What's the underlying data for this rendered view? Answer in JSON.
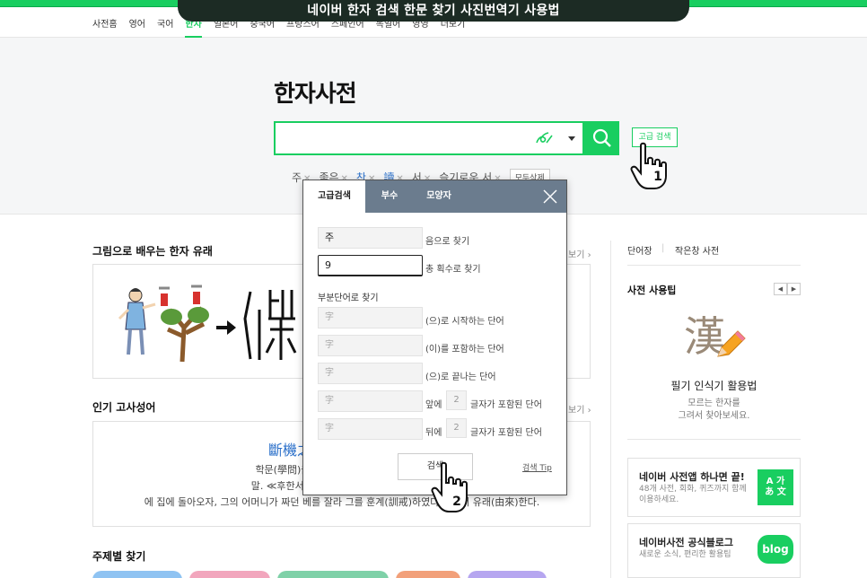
{
  "banner": {
    "title": "네이버 한자 검색 한문 찾기 사진번역기 사용법"
  },
  "nav": {
    "items": [
      "사전홈",
      "영어",
      "국어",
      "한자",
      "일본어",
      "중국어",
      "프랑스어",
      "스페인어",
      "독일어",
      "영영",
      "더보기"
    ],
    "active_index": 3
  },
  "hero": {
    "title": "한자사전",
    "search_value": "",
    "advanced_label": "고급 검색",
    "recent": [
      {
        "text": "주",
        "color": "gray"
      },
      {
        "text": "좋은",
        "color": "gray"
      },
      {
        "text": "찬",
        "color": "blue"
      },
      {
        "text": "讀",
        "color": "blue"
      },
      {
        "text": "서",
        "color": "gray"
      },
      {
        "text": "슬기로운 서",
        "color": "gray"
      }
    ],
    "delete_all": "모두삭제",
    "step1": "1"
  },
  "left": {
    "origin_title": "그림으로 배우는 한자 유래",
    "more": "보기",
    "idiom_title": "인기 고사성어",
    "idiom_hanja": "斷機之",
    "idiom_lines": [
      "학문(學問)을 중도(中途)에서 그만두면 짜",
      "말. ≪후한서(後漢書)≫의 <열녀전(列女傳",
      "에 집에 돌아오자, 그의 어머니가 짜던 베를 잘라 그를 훈계(訓戒)하였다는 데서 유래(由來)한다."
    ],
    "topic_title": "주제별 찾기"
  },
  "right": {
    "link1": "단어장",
    "link2": "작은창 사전",
    "tip_section": "사전 사용팁",
    "tip_glyph": "漢",
    "tip_title": "필기 인식기 활용법",
    "tip_desc1": "모르는 한자를",
    "tip_desc2": "그려서 찾아보세요.",
    "promo1_title": "네이버 사전앱 하나면 끝!",
    "promo1_desc": "48개 사전, 회화, 퀴즈까지 함께 이용하세요.",
    "promo1_badge": "A 가 あ 文",
    "promo2_title": "네이버사전 공식블로그",
    "promo2_desc": "새로운 소식, 편리한 활용팁",
    "promo2_badge": "blog"
  },
  "modal": {
    "tabs": [
      "고급검색",
      "부수",
      "모양자"
    ],
    "reading_value": "주",
    "reading_label": "음으로 찾기",
    "strokes_value": "9",
    "strokes_label": "총 획수로 찾기",
    "partial_title": "부분단어로 찾기",
    "placeholder": "字",
    "rows": [
      {
        "label": "(으)로 시작하는 단어"
      },
      {
        "label": "(이)를 포함하는 단어"
      },
      {
        "label": "(으)로 끝나는 단어"
      }
    ],
    "before_label": "앞에",
    "after_label": "뒤에",
    "count_value": "2",
    "count_suffix": "글자가 포함된 단어",
    "search_label": "검색",
    "tip_label": "검색 Tip",
    "step2": "2"
  },
  "colors": {
    "accent": "#19ce60",
    "link": "#2a6fc9",
    "modal_header": "#6b7c8e"
  }
}
